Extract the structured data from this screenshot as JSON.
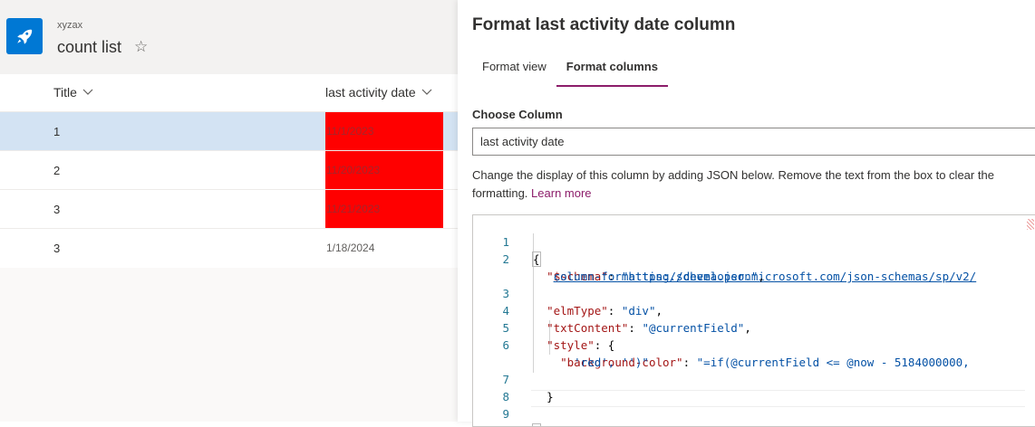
{
  "site": {
    "name": "xyzax",
    "list_title": "count list"
  },
  "grid": {
    "columns": [
      "Title",
      "last activity date"
    ],
    "rows": [
      {
        "title": "1",
        "date": "11/1/2023",
        "highlight": true,
        "selected": true
      },
      {
        "title": "2",
        "date": "11/20/2023",
        "highlight": true,
        "selected": false
      },
      {
        "title": "3",
        "date": "11/21/2023",
        "highlight": true,
        "selected": false
      },
      {
        "title": "3",
        "date": "1/18/2024",
        "highlight": false,
        "selected": false
      }
    ]
  },
  "panel": {
    "title": "Format last activity date column",
    "tabs": [
      "Format view",
      "Format columns"
    ],
    "active_tab": "Format columns",
    "choose_label": "Choose Column",
    "column_value": "last activity date",
    "description": "Change the display of this column by adding JSON below. Remove the text from the box to clear the formatting.",
    "learn_more": "Learn more"
  },
  "code": {
    "line_numbers": [
      "1",
      "2",
      "3",
      "4",
      "5",
      "6",
      "7",
      "8",
      "9"
    ],
    "schema_key": "\"$schema\"",
    "schema_url_1": "https://developer.microsoft.com/json-schemas/sp/v2/",
    "schema_url_2": "column-formatting.schema.json",
    "elm_key": "\"elmType\"",
    "elm_val": "\"div\"",
    "txt_key": "\"txtContent\"",
    "txt_val": "\"@currentField\"",
    "style_key": "\"style\"",
    "bg_key": "\"background-color\"",
    "bg_val_1": "\"=if(@currentField <= @now - 5184000000,",
    "bg_val_2": "'red', '')\""
  },
  "colors": {
    "accent": "#8c1d6a",
    "brand": "#0078d4",
    "highlight": "#ff0000",
    "selected_row": "#d3e3f3"
  }
}
